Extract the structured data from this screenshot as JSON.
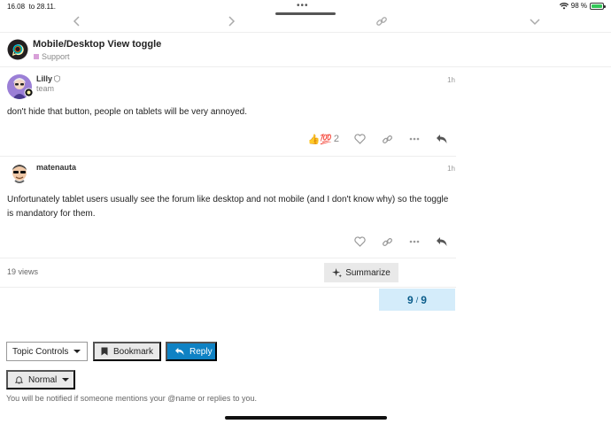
{
  "status_bar": {
    "time": "16.08",
    "date": "to 28.11.",
    "battery": "98 %",
    "battery_level": 0.98
  },
  "browser": {
    "more_label": "•••"
  },
  "topic": {
    "title": "Mobile/Desktop View toggle",
    "category": "Support",
    "category_color": "#d8a0d8"
  },
  "posts": [
    {
      "username": "Lilly",
      "user_title": "team",
      "time": "1h",
      "body": "don't hide that button, people on tablets will be very annoyed.",
      "reactions": "👍💯",
      "reaction_count": "2"
    },
    {
      "username": "matenauta",
      "user_title": "",
      "time": "1h",
      "body": "Unfortunately tablet users usually see the forum like desktop and not mobile (and I don't know why) so the toggle is mandatory for them."
    }
  ],
  "meta": {
    "views": "19 views",
    "summarize_label": "Summarize"
  },
  "progress": {
    "current": "9",
    "separator": "/",
    "total": "9"
  },
  "controls": {
    "topic_controls_label": "Topic Controls",
    "bookmark_label": "Bookmark",
    "reply_label": "Reply",
    "notification_level": "Normal",
    "notification_text": "You will be notified if someone mentions your @name or replies to you."
  },
  "colors": {
    "accent": "#0f82c4",
    "progress_bg": "#d4ecfa"
  }
}
